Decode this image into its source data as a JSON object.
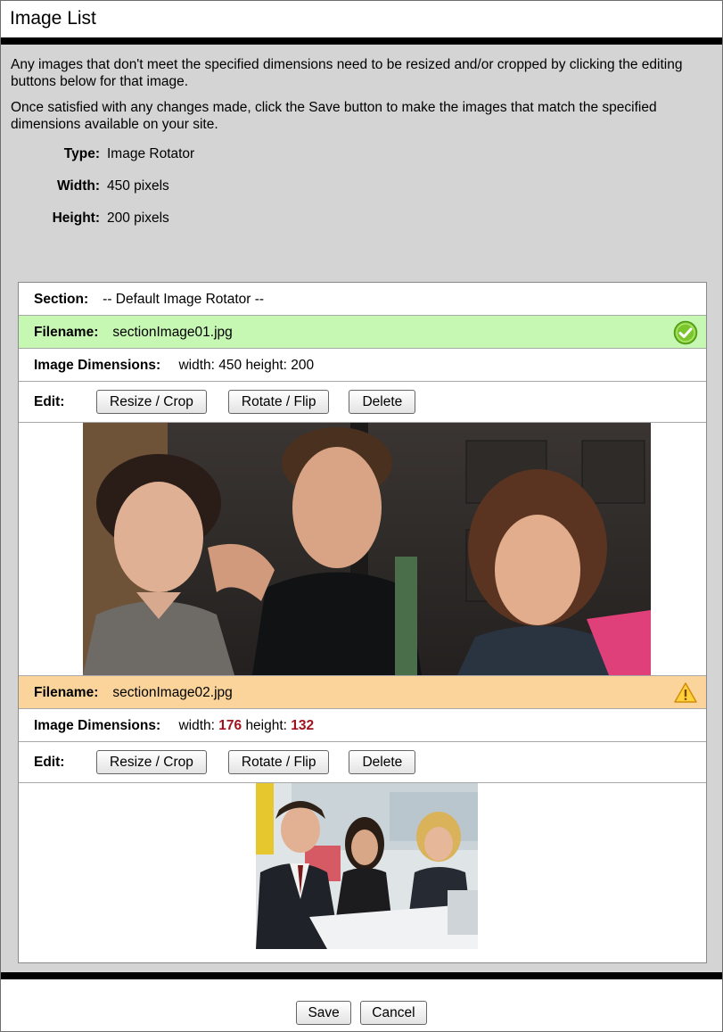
{
  "dialog": {
    "title": "Image List",
    "intro_1": "Any images that don't meet the specified dimensions need to be resized and/or cropped by clicking the editing buttons below for that image.",
    "intro_2": "Once satisfied with any changes made, click the Save button to make the images that match the specified dimensions available on your site."
  },
  "meta": {
    "type_label": "Type:",
    "type_value": "Image Rotator",
    "width_label": "Width:",
    "width_value": "450 pixels",
    "height_label": "Height:",
    "height_value": "200 pixels"
  },
  "section": {
    "label": "Section:",
    "value": "-- Default Image Rotator --"
  },
  "images": [
    {
      "filename_label": "Filename:",
      "filename": "sectionImage01.jpg",
      "status_icon": "check-circle-icon",
      "status_color": "#c6f7b3",
      "dims_label": "Image Dimensions:",
      "width_text": "width:",
      "width": "450",
      "height_text": "height:",
      "height": "200",
      "edit_label": "Edit:",
      "resize_label": "Resize / Crop",
      "rotate_label": "Rotate / Flip",
      "delete_label": "Delete"
    },
    {
      "filename_label": "Filename:",
      "filename": "sectionImage02.jpg",
      "status_icon": "warning-triangle-icon",
      "status_color": "#fad49a",
      "dims_label": "Image Dimensions:",
      "width_text": "width:",
      "width": "176",
      "height_text": "height:",
      "height": "132",
      "edit_label": "Edit:",
      "resize_label": "Resize / Crop",
      "rotate_label": "Rotate / Flip",
      "delete_label": "Delete"
    }
  ],
  "footer": {
    "save_label": "Save",
    "cancel_label": "Cancel"
  }
}
